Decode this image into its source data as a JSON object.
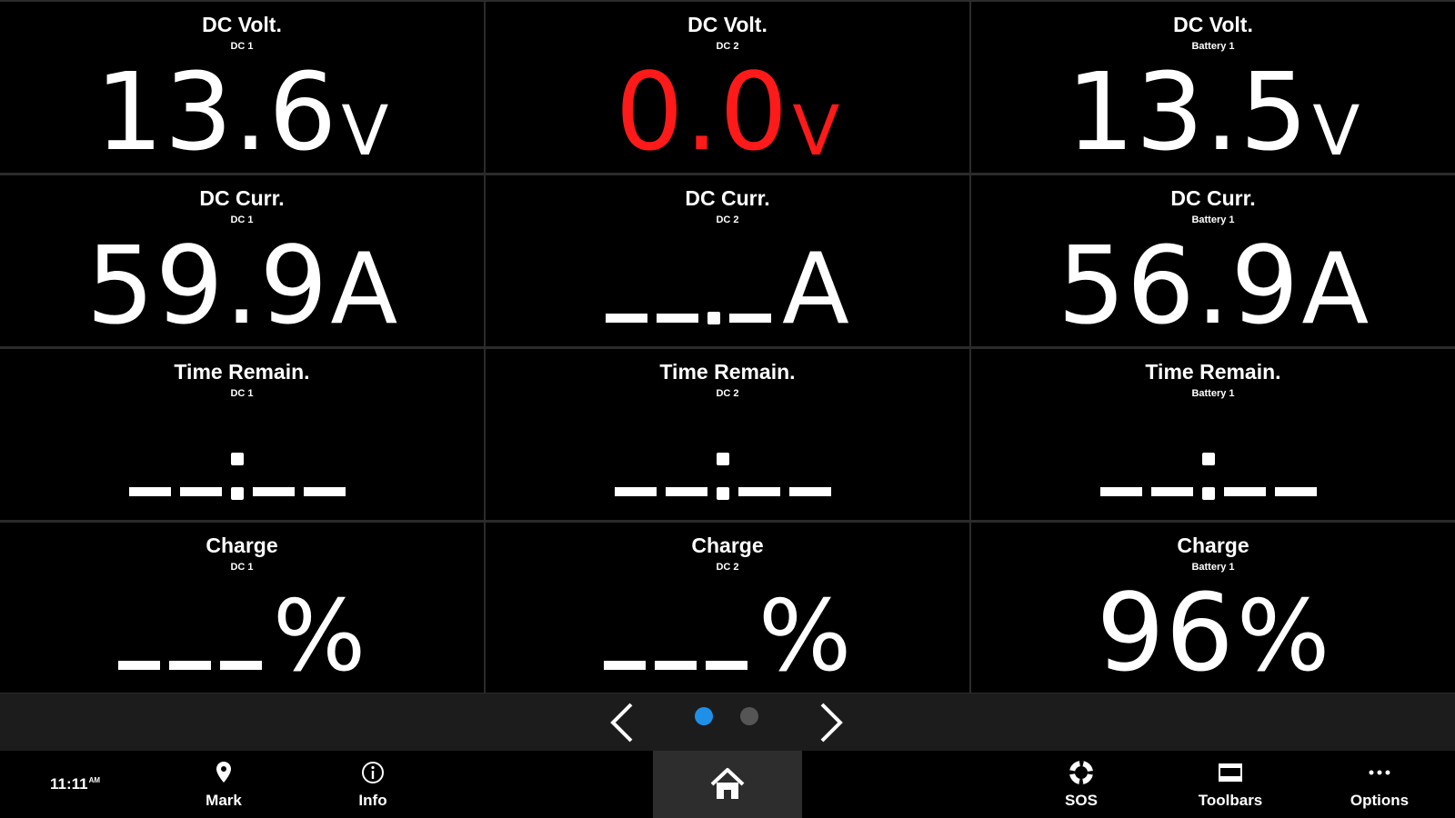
{
  "cells": [
    {
      "title": "DC Volt.",
      "source": "DC 1",
      "value": "13.6",
      "unit": "V"
    },
    {
      "title": "DC Volt.",
      "source": "DC 2",
      "value": "0.0",
      "unit": "V",
      "alert_color": "#ff1a1a"
    },
    {
      "title": "DC Volt.",
      "source": "Battery 1",
      "value": "13.5",
      "unit": "V"
    },
    {
      "title": "DC Curr.",
      "source": "DC 1",
      "value": "59.9",
      "unit": "A"
    },
    {
      "title": "DC Curr.",
      "source": "DC 2",
      "value": "__._",
      "unit": "A"
    },
    {
      "title": "DC Curr.",
      "source": "Battery 1",
      "value": "56.9",
      "unit": "A"
    },
    {
      "title": "Time Remain.",
      "source": "DC 1",
      "value": "__:__"
    },
    {
      "title": "Time Remain.",
      "source": "DC 2",
      "value": "__:__"
    },
    {
      "title": "Time Remain.",
      "source": "Battery 1",
      "value": "__:__"
    },
    {
      "title": "Charge",
      "source": "DC 1",
      "value": "___",
      "unit": "%"
    },
    {
      "title": "Charge",
      "source": "DC 2",
      "value": "___",
      "unit": "%"
    },
    {
      "title": "Charge",
      "source": "Battery 1",
      "value": "96",
      "unit": "%"
    }
  ],
  "pager": {
    "current_page": 1,
    "total_pages": 2,
    "active_color": "#1e90e8",
    "icons": {
      "prev": "chevron-left-icon",
      "next": "chevron-right-icon"
    }
  },
  "navbar": {
    "clock": {
      "time": "11:11",
      "ampm": "AM"
    },
    "mark": {
      "label": "Mark",
      "icon": "map-pin-icon"
    },
    "info": {
      "label": "Info",
      "icon": "info-icon"
    },
    "home": {
      "icon": "home-icon"
    },
    "sos": {
      "label": "SOS",
      "icon": "lifebuoy-icon"
    },
    "toolbars": {
      "label": "Toolbars",
      "icon": "toolbars-icon"
    },
    "options": {
      "label": "Options",
      "icon": "more-dots-icon"
    }
  }
}
